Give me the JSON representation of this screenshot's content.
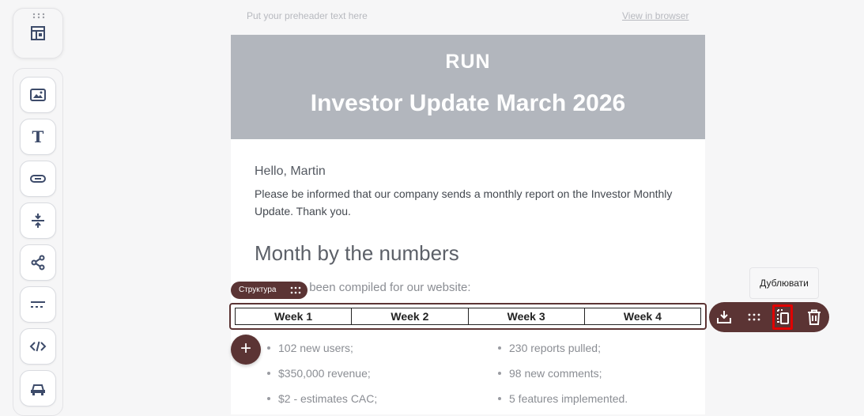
{
  "toolbar": {
    "layout_tool": "layout-icon",
    "tools": [
      {
        "name": "image-icon"
      },
      {
        "name": "text-icon"
      },
      {
        "name": "button-icon"
      },
      {
        "name": "spacer-icon"
      },
      {
        "name": "social-icon"
      },
      {
        "name": "divider-icon"
      },
      {
        "name": "html-icon"
      },
      {
        "name": "menu-icon"
      }
    ]
  },
  "email": {
    "preheader": "Put your preheader text here",
    "view_in_browser": "View in browser",
    "brand": "RUN",
    "hero_title": "Investor Update March 2026",
    "greeting": "Hello, Martin",
    "intro": "Please be informed that our company sends a monthly report on the Investor Monthly Update. Thank you.",
    "section_title": "Month by the numbers",
    "subline": "dates has been compiled for our website:",
    "weeks": [
      "Week 1",
      "Week 2",
      "Week 3",
      "Week 4"
    ],
    "left_list": [
      "102 new users;",
      "$350,000 revenue;",
      "$2 - estimates CAC;"
    ],
    "right_list": [
      "230 reports pulled;",
      "98 new comments;",
      "5 features implemented."
    ]
  },
  "editor": {
    "structure_label": "Структура",
    "add_button": "+",
    "tooltip": "Дублювати"
  },
  "colors": {
    "accent": "#5b3434",
    "hero_bg": "#b2b6bd",
    "highlight": "#e10000"
  }
}
